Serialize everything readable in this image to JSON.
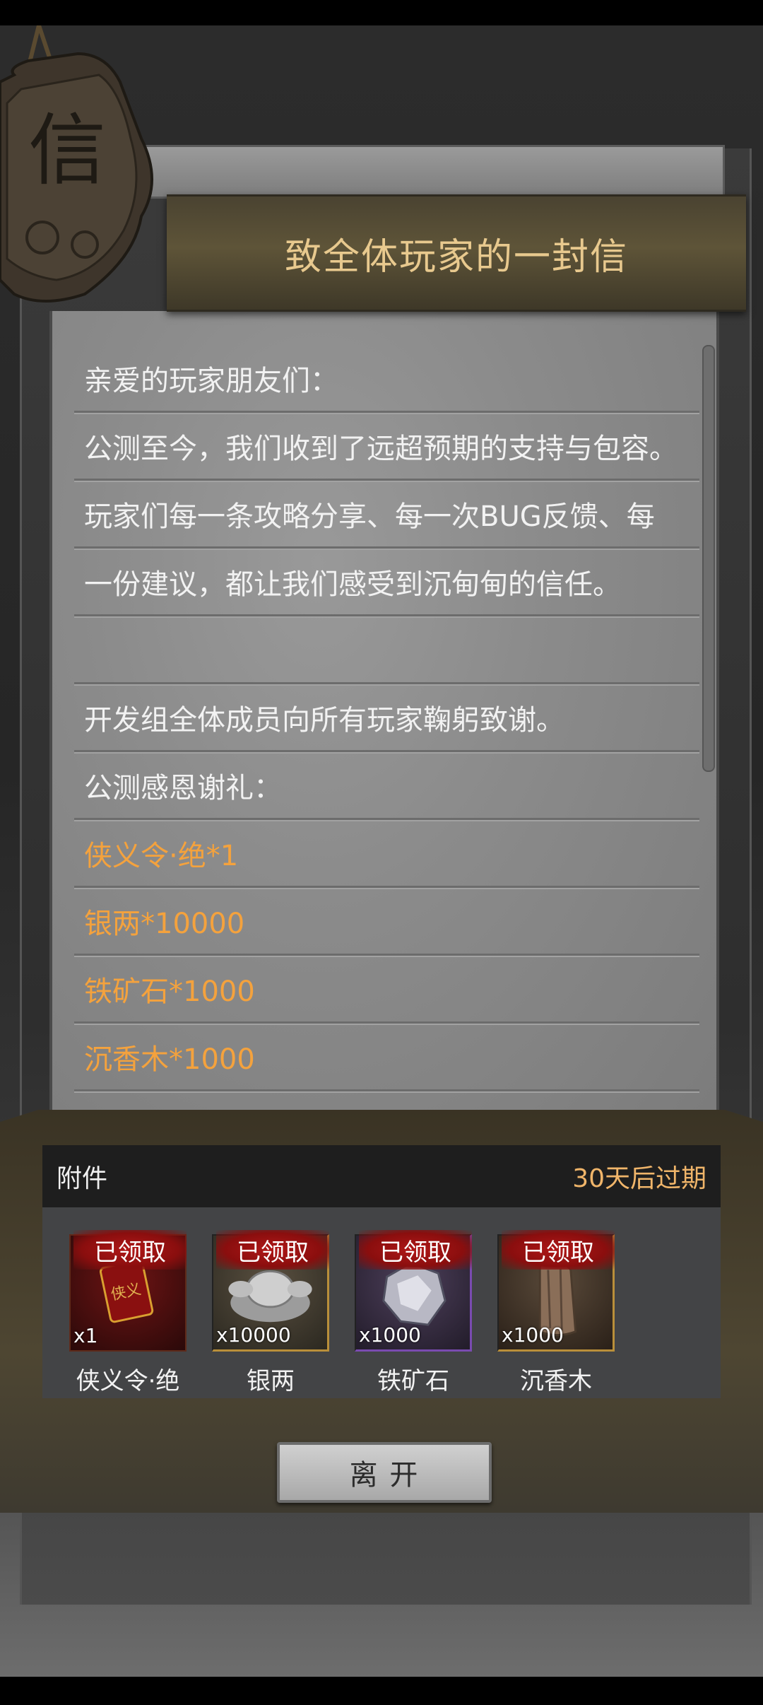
{
  "title": "致全体玩家的一封信",
  "seal_char": "信",
  "letter_lines": [
    {
      "text": "亲爱的玩家朋友们：",
      "style": "normal"
    },
    {
      "text": "公测至今，我们收到了远超预期的支持与包容。",
      "style": "normal"
    },
    {
      "text": "玩家们每一条攻略分享、每一次BUG反馈、每",
      "style": "normal"
    },
    {
      "text": "一份建议，都让我们感受到沉甸甸的信任。",
      "style": "normal"
    },
    {
      "text": "",
      "style": "normal"
    },
    {
      "text": "开发组全体成员向所有玩家鞠躬致谢。",
      "style": "normal"
    },
    {
      "text": "公测感恩谢礼：",
      "style": "normal"
    },
    {
      "text": "侠义令·绝*1",
      "style": "gold"
    },
    {
      "text": "银两*10000",
      "style": "gold"
    },
    {
      "text": "铁矿石*1000",
      "style": "gold"
    },
    {
      "text": "沉香木*1000",
      "style": "gold"
    }
  ],
  "attachments": {
    "label": "附件",
    "expire": "30天后过期",
    "items": [
      {
        "name": "侠义令·绝",
        "qty": "x1",
        "status": "已领取",
        "icon": "token-icon",
        "rarity": "red"
      },
      {
        "name": "银两",
        "qty": "x10000",
        "status": "已领取",
        "icon": "silver-ingot-icon",
        "rarity": "gold"
      },
      {
        "name": "铁矿石",
        "qty": "x1000",
        "status": "已领取",
        "icon": "iron-ore-icon",
        "rarity": "purple"
      },
      {
        "name": "沉香木",
        "qty": "x1000",
        "status": "已领取",
        "icon": "agarwood-icon",
        "rarity": "brown"
      }
    ]
  },
  "leave_button": "离 开",
  "colors": {
    "title": "#e8c98e",
    "reward_text": "#f4a23d",
    "expire_text": "#f0b56a"
  }
}
